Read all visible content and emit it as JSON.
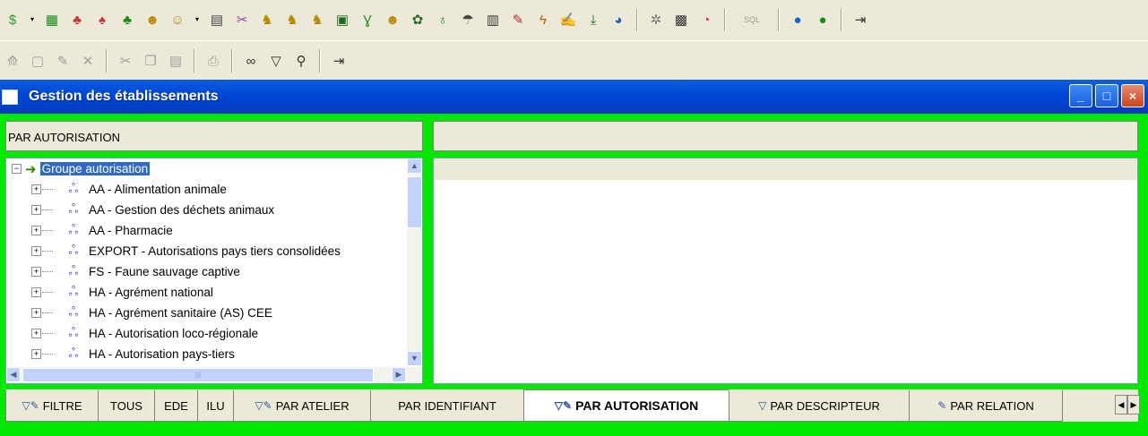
{
  "toolbar_main": {
    "icons": [
      "dollar-icon",
      "chevron-down-icon",
      "calculator-icon",
      "users-icon",
      "user-remove-icon",
      "tree-icon",
      "people-icon",
      "people-group-icon",
      "chevron-down-icon",
      "document-icon",
      "scissors-icon",
      "animal-group-icon",
      "animal-group-2-icon",
      "animal-group-3-icon",
      "register-icon",
      "vector-icon",
      "crowd-icon",
      "mask-icon",
      "flask-icon",
      "umbrella-icon",
      "building-icon",
      "pencil-icon",
      "lightning-icon",
      "edit-note-icon",
      "download-icon",
      "globe-icon",
      "gear-icon",
      "report-icon",
      "pie-chart-icon",
      "globe-blue-icon",
      "globe-green-icon",
      "exit-icon"
    ],
    "sql_label": "SQL"
  },
  "toolbar_edit": {
    "icons": [
      "new-record-icon",
      "blank-page-icon",
      "properties-icon",
      "delete-icon",
      "cut-icon",
      "copy-icon",
      "paste-icon",
      "print-icon",
      "binoculars-icon",
      "filter-icon",
      "zoom-icon",
      "exit-icon"
    ]
  },
  "window": {
    "title": "Gestion des établissements",
    "minimize": "_",
    "maximize": "□",
    "close": "×"
  },
  "left_pane": {
    "header": "PAR AUTORISATION"
  },
  "tree": {
    "root": "Groupe autorisation",
    "items": [
      "AA - Alimentation animale",
      "AA - Gestion des déchets animaux",
      "AA - Pharmacie",
      "EXPORT - Autorisations pays tiers consolidées",
      "FS - Faune sauvage captive",
      "HA - Agrément national",
      "HA - Agrément sanitaire (AS) CEE",
      "HA - Autorisation loco-régionale",
      "HA - Autorisation pays-tiers"
    ]
  },
  "tabs": {
    "filtre": "FILTRE",
    "tous": "TOUS",
    "ede": "EDE",
    "ilu": "ILU",
    "par_atelier": "PAR ATELIER",
    "par_identifiant": "PAR IDENTIFIANT",
    "par_autorisation": "PAR AUTORISATION",
    "par_descripteur": "PAR DESCRIPTEUR",
    "par_relation": "PAR RELATION"
  }
}
